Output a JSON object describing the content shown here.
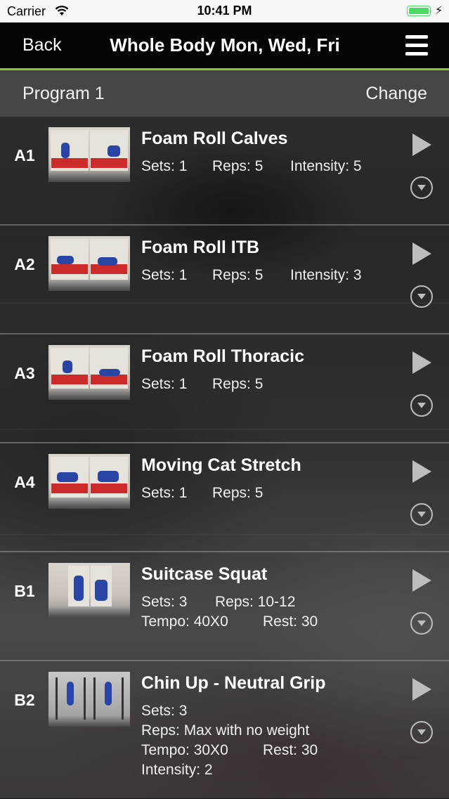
{
  "status_bar": {
    "carrier": "Carrier",
    "time": "10:41 PM",
    "wifi_icon": "wifi-icon",
    "battery_icon": "battery-charging-icon",
    "battery_level": 1.0,
    "battery_color": "#4cd964"
  },
  "nav": {
    "back_label": "Back",
    "title": "Whole Body Mon, Wed, Fri",
    "menu_icon": "hamburger-menu-icon",
    "accent_color": "#8ac43f"
  },
  "program": {
    "name": "Program 1",
    "change_label": "Change"
  },
  "exercises": [
    {
      "code": "A1",
      "name": "Foam Roll Calves",
      "lines": [
        [
          "Sets: 1",
          "Reps: 5",
          "Intensity: 5"
        ]
      ]
    },
    {
      "code": "A2",
      "name": "Foam Roll ITB",
      "lines": [
        [
          "Sets: 1",
          "Reps: 5",
          "Intensity: 3"
        ]
      ]
    },
    {
      "code": "A3",
      "name": "Foam Roll Thoracic",
      "lines": [
        [
          "Sets: 1",
          "Reps: 5"
        ]
      ]
    },
    {
      "code": "A4",
      "name": "Moving Cat Stretch",
      "lines": [
        [
          "Sets: 1",
          "Reps: 5"
        ]
      ]
    },
    {
      "code": "B1",
      "name": "Suitcase Squat",
      "lines": [
        [
          "Sets: 3",
          "Reps: 10-12"
        ],
        [
          "Tempo: 40X0",
          "Rest: 30"
        ]
      ]
    },
    {
      "code": "B2",
      "name": "Chin Up - Neutral Grip",
      "lines": [
        [
          "Sets: 3"
        ],
        [
          "Reps: Max with no weight"
        ],
        [
          "Tempo: 30X0",
          "Rest: 30"
        ],
        [
          "Intensity: 2"
        ]
      ]
    }
  ],
  "icons": {
    "play": "play-icon",
    "expand": "chevron-down-circle-icon"
  }
}
